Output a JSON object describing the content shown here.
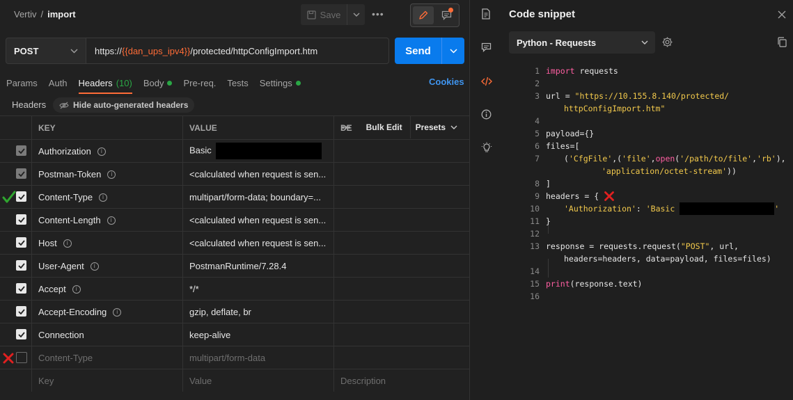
{
  "breadcrumb": {
    "workspace": "Vertiv",
    "separator": "/",
    "request": "import"
  },
  "toolbar": {
    "save_label": "Save",
    "more_label": "•••"
  },
  "request": {
    "method": "POST",
    "url_prefix": "https://",
    "url_variable": "{{dan_ups_ipv4}}",
    "url_suffix": "/protected/httpConfigImport.htm",
    "send_label": "Send"
  },
  "tabs": [
    {
      "label": "Params"
    },
    {
      "label": "Auth"
    },
    {
      "label": "Headers",
      "count": "(10)"
    },
    {
      "label": "Body",
      "dot": true
    },
    {
      "label": "Pre-req."
    },
    {
      "label": "Tests"
    },
    {
      "label": "Settings",
      "dot": true
    }
  ],
  "cookies_label": "Cookies",
  "headers_section": {
    "title": "Headers",
    "hide_auto_label": "Hide auto-generated headers"
  },
  "table": {
    "columns": {
      "key": "KEY",
      "value": "VALUE",
      "description": "DE"
    },
    "more_label": "•••",
    "bulk_edit_label": "Bulk Edit",
    "presets_label": "Presets",
    "rows": [
      {
        "key": "Authorization",
        "value": "Basic",
        "state": "gray"
      },
      {
        "key": "Postman-Token",
        "value": "<calculated when request is sen...",
        "state": "gray"
      },
      {
        "key": "Content-Type",
        "value": "multipart/form-data; boundary=...",
        "state": "checked"
      },
      {
        "key": "Content-Length",
        "value": "<calculated when request is sen...",
        "state": "checked"
      },
      {
        "key": "Host",
        "value": "<calculated when request is sen...",
        "state": "checked"
      },
      {
        "key": "User-Agent",
        "value": "PostmanRuntime/7.28.4",
        "state": "checked"
      },
      {
        "key": "Accept",
        "value": "*/*",
        "state": "checked"
      },
      {
        "key": "Accept-Encoding",
        "value": "gzip, deflate, br",
        "state": "checked"
      },
      {
        "key": "Connection",
        "value": "keep-alive",
        "state": "checked"
      },
      {
        "key": "Content-Type",
        "value": "multipart/form-data",
        "state": "unchecked"
      }
    ],
    "placeholder": {
      "key": "Key",
      "value": "Value",
      "description": "Description"
    }
  },
  "snippet": {
    "title": "Code snippet",
    "language": "Python - Requests",
    "lines": [
      {
        "n": "1",
        "text": "import requests"
      },
      {
        "n": "2",
        "text": ""
      },
      {
        "n": "3",
        "text": "url = \"https://10.155.8.140/protected/"
      },
      {
        "n": "",
        "text": "httpConfigImport.htm\""
      },
      {
        "n": "4",
        "text": ""
      },
      {
        "n": "5",
        "text": "payload={}"
      },
      {
        "n": "6",
        "text": "files=["
      },
      {
        "n": "7",
        "text": "('CfgFile',('file',open('/path/to/file','rb'),"
      },
      {
        "n": "",
        "text": "'application/octet-stream'))"
      },
      {
        "n": "8",
        "text": "]"
      },
      {
        "n": "9",
        "text": "headers = {"
      },
      {
        "n": "10",
        "text": "'Authorization': 'Basic"
      },
      {
        "n": "11",
        "text": "}"
      },
      {
        "n": "12",
        "text": ""
      },
      {
        "n": "13",
        "text": "response = requests.request(\"POST\", url,"
      },
      {
        "n": "",
        "text": "headers=headers, data=payload, files=files)"
      },
      {
        "n": "14",
        "text": ""
      },
      {
        "n": "15",
        "text": "print(response.text)"
      },
      {
        "n": "16",
        "text": ""
      }
    ]
  },
  "colors": {
    "accent": "#ff6c37",
    "send": "#097bed",
    "link": "#3f95f0",
    "success": "#2aa745",
    "error": "#e02020"
  }
}
